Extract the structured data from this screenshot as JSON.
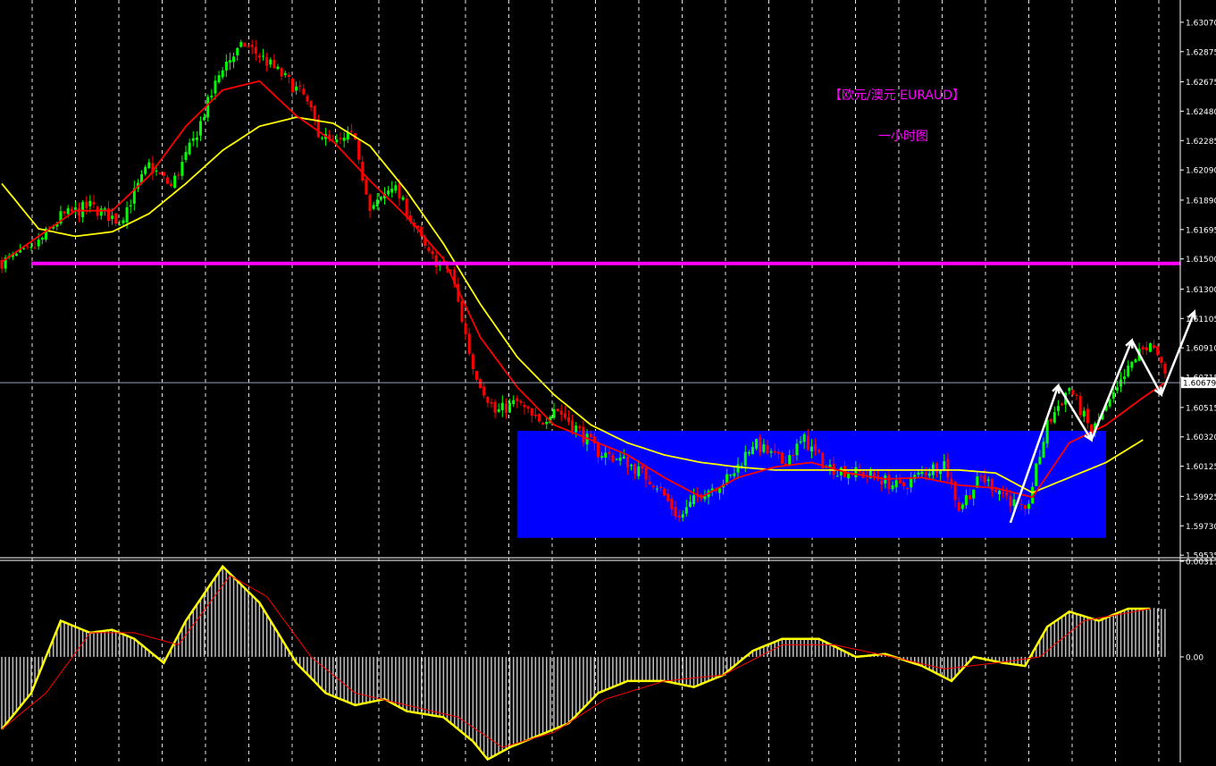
{
  "colors": {
    "background": "#000000",
    "bull_candle": "#00ff00",
    "bear_candle": "#ff0000",
    "ma_fast": "#ff0000",
    "ma_slow": "#ffff00",
    "resistance_line": "#ff00ff",
    "range_box": "#0000ff",
    "title_text": "#ff00ff",
    "grid": "#ffffff",
    "axis_text": "#ffffff",
    "price_tag_bg": "#ffffff",
    "macd_hist": "#c0c0c0",
    "macd_line": "#ffff00",
    "signal_line": "#ff0000",
    "arrow": "#ffffff"
  },
  "titles": {
    "main": "【欧元/澳元 EURAUD】",
    "sub": "一小时图"
  },
  "chart_data": [
    {
      "type": "candlestick",
      "title": "【欧元/澳元 EURAUD】",
      "subtitle": "一小时图",
      "ylim": [
        1.5953,
        1.6317
      ],
      "y_ticks": [
        "1.63070",
        "1.62875",
        "1.62675",
        "1.62480",
        "1.62285",
        "1.62090",
        "1.61890",
        "1.61695",
        "1.61500",
        "1.61300",
        "1.61105",
        "1.60910",
        "1.60715",
        "1.60515",
        "1.60320",
        "1.60125",
        "1.59925",
        "1.59730",
        "1.59535"
      ],
      "current_price": "1.60679",
      "current_price_value": 1.60679,
      "grid": "vertical dashed",
      "close_path": [
        [
          0,
          1.6148
        ],
        [
          8,
          1.6155
        ],
        [
          16,
          1.6178
        ],
        [
          24,
          1.6185
        ],
        [
          32,
          1.6175
        ],
        [
          40,
          1.6212
        ],
        [
          46,
          1.6198
        ],
        [
          52,
          1.6228
        ],
        [
          60,
          1.6278
        ],
        [
          66,
          1.6292
        ],
        [
          70,
          1.6285
        ],
        [
          76,
          1.6272
        ],
        [
          82,
          1.6258
        ],
        [
          86,
          1.6235
        ],
        [
          90,
          1.6225
        ],
        [
          96,
          1.6232
        ],
        [
          100,
          1.618
        ],
        [
          106,
          1.62
        ],
        [
          110,
          1.6182
        ],
        [
          116,
          1.6152
        ],
        [
          122,
          1.6142
        ],
        [
          128,
          1.6078
        ],
        [
          134,
          1.6048
        ],
        [
          140,
          1.6055
        ],
        [
          146,
          1.604
        ],
        [
          150,
          1.6052
        ],
        [
          156,
          1.6038
        ],
        [
          162,
          1.6022
        ],
        [
          170,
          1.6015
        ],
        [
          178,
          1.6
        ],
        [
          184,
          1.5978
        ],
        [
          190,
          1.5995
        ],
        [
          198,
          1.6005
        ],
        [
          204,
          1.6028
        ],
        [
          212,
          1.6015
        ],
        [
          218,
          1.603
        ],
        [
          224,
          1.6012
        ],
        [
          232,
          1.6008
        ],
        [
          238,
          1.6005
        ],
        [
          244,
          1.5998
        ],
        [
          250,
          1.6008
        ],
        [
          256,
          1.6015
        ],
        [
          260,
          1.5985
        ],
        [
          266,
          1.6005
        ],
        [
          272,
          1.5995
        ],
        [
          278,
          1.598
        ],
        [
          284,
          1.604
        ],
        [
          290,
          1.6065
        ],
        [
          296,
          1.6035
        ],
        [
          302,
          1.6058
        ],
        [
          308,
          1.6085
        ],
        [
          312,
          1.6095
        ],
        [
          316,
          1.6072
        ]
      ],
      "ma_fast_path": [
        [
          0,
          1.6148
        ],
        [
          10,
          1.6165
        ],
        [
          20,
          1.6182
        ],
        [
          30,
          1.6182
        ],
        [
          40,
          1.6205
        ],
        [
          50,
          1.6238
        ],
        [
          60,
          1.6262
        ],
        [
          70,
          1.6268
        ],
        [
          80,
          1.6245
        ],
        [
          90,
          1.6228
        ],
        [
          100,
          1.6202
        ],
        [
          110,
          1.6178
        ],
        [
          120,
          1.615
        ],
        [
          130,
          1.6098
        ],
        [
          140,
          1.6065
        ],
        [
          150,
          1.604
        ],
        [
          160,
          1.603
        ],
        [
          170,
          1.602
        ],
        [
          180,
          1.6005
        ],
        [
          190,
          1.5992
        ],
        [
          200,
          1.6005
        ],
        [
          210,
          1.6012
        ],
        [
          220,
          1.6015
        ],
        [
          230,
          1.6008
        ],
        [
          240,
          1.6004
        ],
        [
          250,
          1.6005
        ],
        [
          260,
          1.6
        ],
        [
          270,
          1.5998
        ],
        [
          280,
          1.5992
        ],
        [
          290,
          1.6028
        ],
        [
          300,
          1.604
        ],
        [
          310,
          1.6058
        ],
        [
          316,
          1.6068
        ]
      ],
      "ma_slow_path": [
        [
          0,
          1.62
        ],
        [
          10,
          1.617
        ],
        [
          20,
          1.6165
        ],
        [
          30,
          1.6168
        ],
        [
          40,
          1.618
        ],
        [
          50,
          1.62
        ],
        [
          60,
          1.6222
        ],
        [
          70,
          1.6238
        ],
        [
          80,
          1.6244
        ],
        [
          90,
          1.624
        ],
        [
          100,
          1.6225
        ],
        [
          110,
          1.6195
        ],
        [
          120,
          1.616
        ],
        [
          130,
          1.612
        ],
        [
          140,
          1.6085
        ],
        [
          150,
          1.606
        ],
        [
          160,
          1.604
        ],
        [
          170,
          1.6028
        ],
        [
          180,
          1.602
        ],
        [
          190,
          1.6015
        ],
        [
          200,
          1.6012
        ],
        [
          210,
          1.601
        ],
        [
          220,
          1.601
        ],
        [
          230,
          1.601
        ],
        [
          240,
          1.601
        ],
        [
          250,
          1.601
        ],
        [
          260,
          1.601
        ],
        [
          270,
          1.6008
        ],
        [
          280,
          1.5995
        ],
        [
          290,
          1.6005
        ],
        [
          300,
          1.6015
        ],
        [
          310,
          1.603
        ]
      ],
      "resistance_level": 1.6147,
      "range_box": {
        "bar_from": 140,
        "bar_to": 300,
        "price_low": 1.5965,
        "price_high": 1.6036
      },
      "arrow_path": [
        [
          274,
          1.5975
        ],
        [
          287,
          1.6066
        ],
        [
          296,
          1.603
        ],
        [
          307,
          1.6096
        ],
        [
          315,
          1.606
        ],
        [
          324,
          1.6115
        ]
      ],
      "n_bars": 317
    },
    {
      "type": "bar",
      "series_name": "MACD",
      "ylim": [
        -0.0035,
        0.00317
      ],
      "y_ticks": [
        "0.00317",
        "0.00"
      ],
      "hist_path": [
        [
          0,
          -0.0024
        ],
        [
          8,
          -0.0012
        ],
        [
          16,
          0.0012
        ],
        [
          24,
          0.0008
        ],
        [
          30,
          0.0009
        ],
        [
          36,
          0.0006
        ],
        [
          44,
          -0.0002
        ],
        [
          50,
          0.0012
        ],
        [
          60,
          0.003
        ],
        [
          70,
          0.0018
        ],
        [
          80,
          -0.0002
        ],
        [
          88,
          -0.0012
        ],
        [
          96,
          -0.0016
        ],
        [
          104,
          -0.0014
        ],
        [
          110,
          -0.0018
        ],
        [
          120,
          -0.002
        ],
        [
          128,
          -0.0028
        ],
        [
          132,
          -0.0034
        ],
        [
          138,
          -0.003
        ],
        [
          146,
          -0.0026
        ],
        [
          154,
          -0.0022
        ],
        [
          162,
          -0.0012
        ],
        [
          170,
          -0.0008
        ],
        [
          180,
          -0.0008
        ],
        [
          188,
          -0.001
        ],
        [
          196,
          -0.0006
        ],
        [
          204,
          0.0002
        ],
        [
          212,
          0.0006
        ],
        [
          222,
          0.0006
        ],
        [
          232,
          0.0
        ],
        [
          240,
          0.0001
        ],
        [
          250,
          -0.0003
        ],
        [
          258,
          -0.0008
        ],
        [
          264,
          0.0
        ],
        [
          272,
          -0.0002
        ],
        [
          278,
          -0.0003
        ],
        [
          284,
          0.001
        ],
        [
          290,
          0.0015
        ],
        [
          298,
          0.0012
        ],
        [
          306,
          0.0016
        ],
        [
          312,
          0.0016
        ]
      ],
      "signal_path": [
        [
          0,
          -0.0024
        ],
        [
          12,
          -0.0012
        ],
        [
          24,
          0.0008
        ],
        [
          36,
          0.0008
        ],
        [
          48,
          0.0004
        ],
        [
          62,
          0.0027
        ],
        [
          72,
          0.002
        ],
        [
          84,
          0.0
        ],
        [
          96,
          -0.0012
        ],
        [
          110,
          -0.0016
        ],
        [
          124,
          -0.002
        ],
        [
          136,
          -0.003
        ],
        [
          150,
          -0.0025
        ],
        [
          164,
          -0.0014
        ],
        [
          180,
          -0.0008
        ],
        [
          196,
          -0.0006
        ],
        [
          212,
          0.0004
        ],
        [
          226,
          0.0004
        ],
        [
          242,
          0.0
        ],
        [
          256,
          -0.0004
        ],
        [
          270,
          -0.0002
        ],
        [
          282,
          0.0
        ],
        [
          294,
          0.0012
        ],
        [
          312,
          0.0016
        ]
      ]
    }
  ]
}
